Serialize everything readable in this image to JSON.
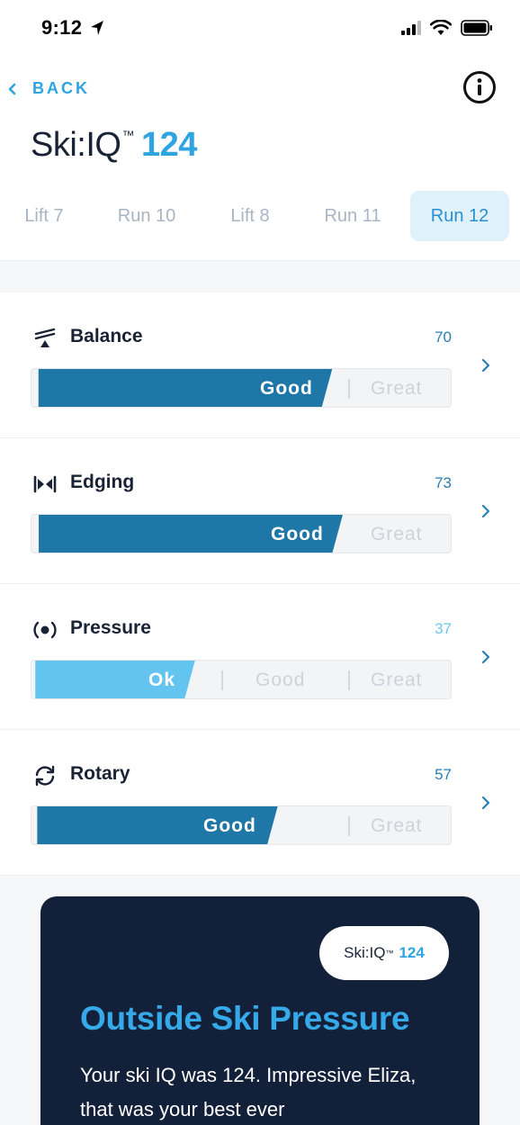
{
  "status_bar": {
    "time": "9:12"
  },
  "nav": {
    "back_label": "BACK"
  },
  "header": {
    "title_prefix": "Ski:IQ",
    "trademark": "™",
    "score": "124"
  },
  "tabs": [
    {
      "label": "Lift 7",
      "active": false
    },
    {
      "label": "Run 10",
      "active": false
    },
    {
      "label": "Lift 8",
      "active": false
    },
    {
      "label": "Run 11",
      "active": false
    },
    {
      "label": "Run 12",
      "active": true
    }
  ],
  "metrics": [
    {
      "name": "Balance",
      "score": "70",
      "icon": "balance-icon",
      "level_label": "Good",
      "next_labels": [
        "Great"
      ]
    },
    {
      "name": "Edging",
      "score": "73",
      "icon": "edging-icon",
      "level_label": "Good",
      "next_labels": [
        "Great"
      ]
    },
    {
      "name": "Pressure",
      "score": "37",
      "icon": "pressure-icon",
      "level_label": "Ok",
      "next_labels": [
        "Good",
        "Great"
      ]
    },
    {
      "name": "Rotary",
      "score": "57",
      "icon": "rotary-icon",
      "level_label": "Good",
      "next_labels": [
        "Great"
      ]
    }
  ],
  "card": {
    "pill_prefix": "Ski:IQ",
    "pill_trademark": "™",
    "pill_score": "124",
    "title": "Outside Ski Pressure",
    "body": "Your ski IQ was 124. Impressive Eliza, that was your best ever"
  },
  "colors": {
    "accent": "#2fa4e0",
    "bar_dark": "#1f77a8",
    "bar_light": "#64c4f0",
    "card_bg": "#13203a",
    "tab_active_bg": "#dff1fb"
  }
}
